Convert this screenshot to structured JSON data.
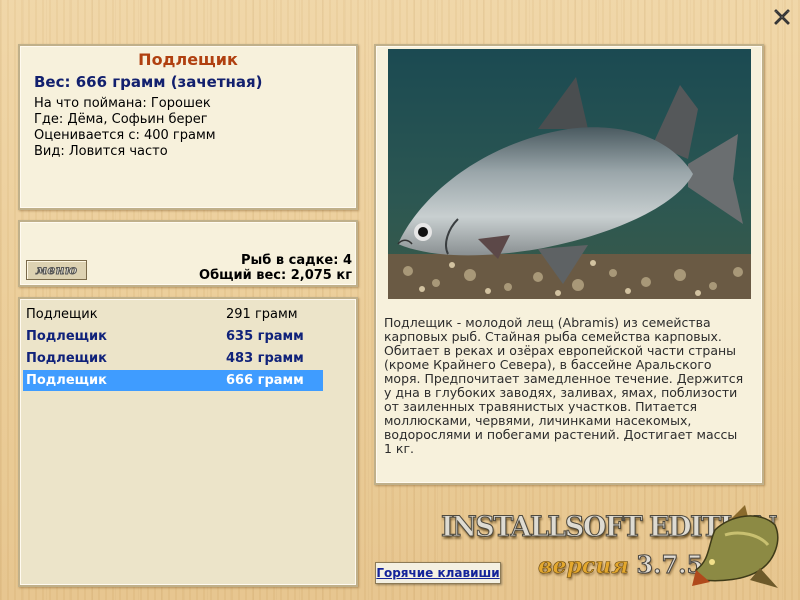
{
  "window": {
    "close_icon": "close-x-icon"
  },
  "fish_info": {
    "name": "Подлещик",
    "weight_line": "Вес: 666 грамм (зачетная)",
    "bait": "На что поймана: Горошек",
    "place": "Где: Дёма, Софьин берег",
    "valued_from": "Оценивается с: 400 грамм",
    "kind": "Вид: Ловится часто"
  },
  "summary": {
    "menu_label": "меню",
    "fish_in_cage": "Рыб в садке: 4",
    "total_weight": "Общий вес: 2,075 кг"
  },
  "catches": [
    {
      "name": "Подлещик",
      "weight": "291 грамм",
      "style": "normal"
    },
    {
      "name": "Подлещик",
      "weight": "635 грамм",
      "style": "bold"
    },
    {
      "name": "Подлещик",
      "weight": "483 грамм",
      "style": "bold"
    },
    {
      "name": "Подлещик",
      "weight": "666 грамм",
      "style": "selected"
    }
  ],
  "description": "Подлещик - молодой лещ (Abramis) из семейства карповых рыб. Стайная рыба семейства карповых. Обитает в реках и озёрах европейской части страны (кроме Крайнего Севера), в бассейне Аральского моря. Предпочитает замедленное течение. Держится у дна в глубоких заводях, заливах, ямах, поблизости от заиленных травянистых участков. Питается моллюсками, червями, личинками насекомых, водорослями и побегами растений. Достигает массы 1 кг.",
  "footer": {
    "hotkeys_label": "Горячие клавиши",
    "brand": "INSTALLSOFT EDITION",
    "version_word": "версия",
    "version_number": "3.7.5"
  },
  "colors": {
    "title": "#b04010",
    "weight": "#12206e",
    "selected_row": "#3f9cff",
    "bold_row": "#10227a",
    "hotkeys_link": "#14239a"
  }
}
